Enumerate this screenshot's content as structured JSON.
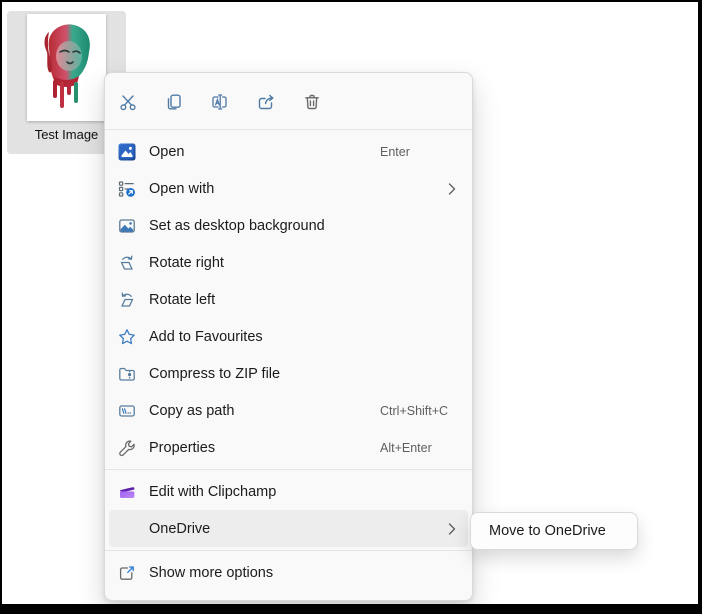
{
  "file_tile": {
    "name": "Test Image"
  },
  "command_bar": {
    "icons": [
      "cut-icon",
      "copy-icon",
      "rename-icon",
      "share-icon",
      "delete-icon"
    ]
  },
  "menu": {
    "items": [
      {
        "label": "Open",
        "shortcut": "Enter",
        "icon": "photos-app-icon"
      },
      {
        "label": "Open with",
        "icon": "open-with-icon",
        "has_submenu": true
      },
      {
        "label": "Set as desktop background",
        "icon": "desktop-background-icon"
      },
      {
        "label": "Rotate right",
        "icon": "rotate-right-icon"
      },
      {
        "label": "Rotate left",
        "icon": "rotate-left-icon"
      },
      {
        "label": "Add to Favourites",
        "icon": "star-icon"
      },
      {
        "label": "Compress to ZIP file",
        "icon": "zip-folder-icon"
      },
      {
        "label": "Copy as path",
        "shortcut": "Ctrl+Shift+C",
        "icon": "copy-path-icon"
      },
      {
        "label": "Properties",
        "shortcut": "Alt+Enter",
        "icon": "wrench-icon"
      },
      {
        "label": "Edit with Clipchamp",
        "icon": "clipchamp-icon"
      },
      {
        "label": "OneDrive",
        "has_submenu": true,
        "hovered": true
      },
      {
        "label": "Show more options",
        "icon": "show-more-icon"
      }
    ]
  },
  "submenu": {
    "move_to_onedrive": "Move to OneDrive"
  },
  "colors": {
    "menu_bg": "#f9f9f9",
    "hover_bg": "#ededed",
    "steel_icon": "#4f7aa6",
    "star_blue": "#3f7fc4",
    "photos_blue": "#1f54a8",
    "clipchamp_purple": "#8a4fe0",
    "shortcut_gray": "#5f5f5f"
  }
}
